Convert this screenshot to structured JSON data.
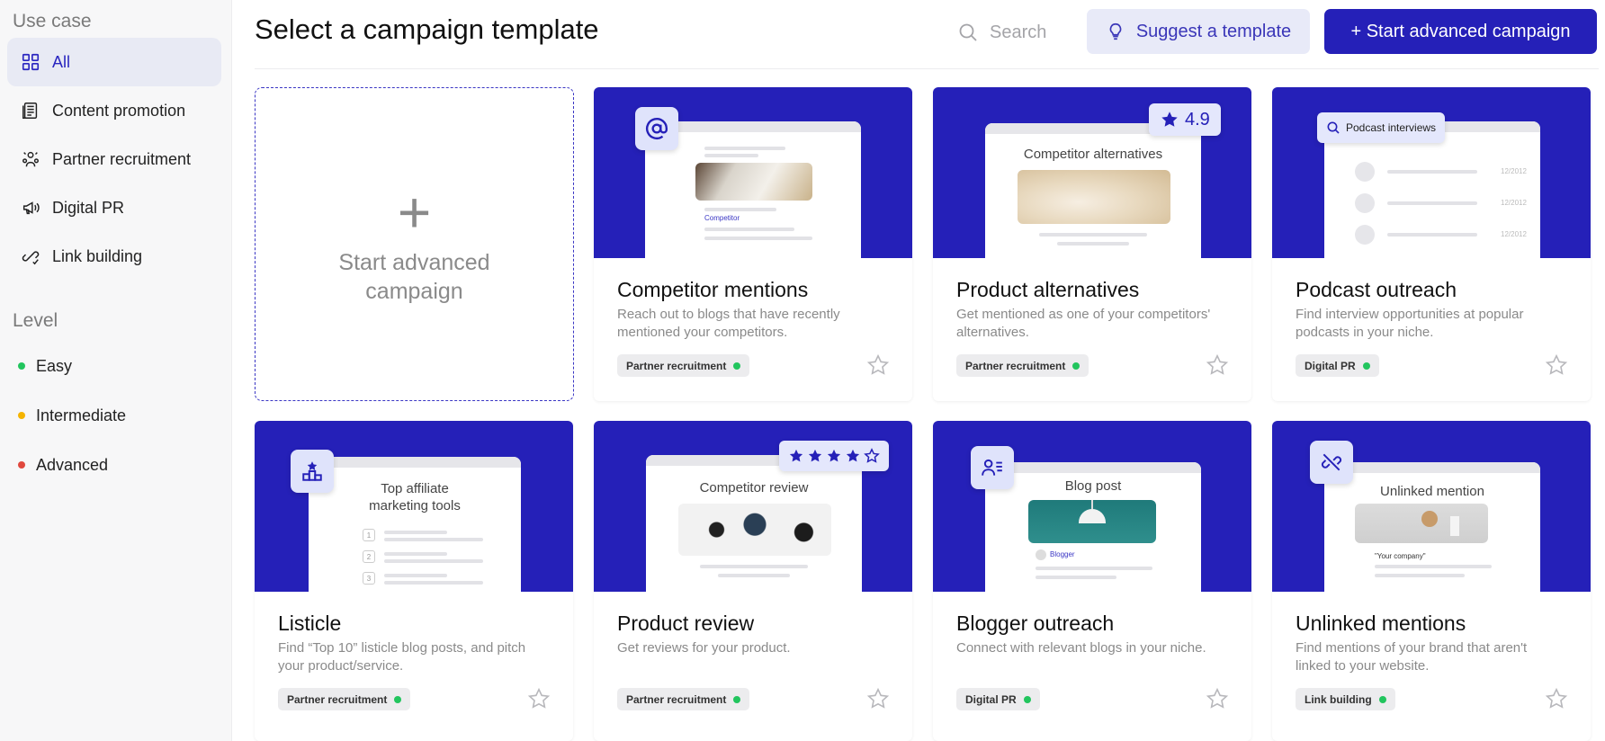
{
  "sidebar": {
    "use_case_heading": "Use case",
    "use_case_items": [
      {
        "label": "All",
        "icon": "grid-icon",
        "active": true
      },
      {
        "label": "Content promotion",
        "icon": "document-icon"
      },
      {
        "label": "Partner recruitment",
        "icon": "partners-icon"
      },
      {
        "label": "Digital PR",
        "icon": "megaphone-icon"
      },
      {
        "label": "Link building",
        "icon": "link-build-icon"
      }
    ],
    "level_heading": "Level",
    "level_items": [
      {
        "label": "Easy",
        "color": "#22c55e"
      },
      {
        "label": "Intermediate",
        "color": "#f5b400"
      },
      {
        "label": "Advanced",
        "color": "#e0483e"
      }
    ]
  },
  "header": {
    "title": "Select a campaign template",
    "search_placeholder": "Search",
    "suggest_label": "Suggest a template",
    "start_label": "+ Start advanced campaign"
  },
  "new_card": {
    "plus": "+",
    "label": "Start advanced campaign"
  },
  "colors": {
    "brand": "#2520b8",
    "tag_green": "#22c55e"
  },
  "cards": [
    {
      "title": "Competitor mentions",
      "description": "Reach out to blogs that have recently mentioned your competitors.",
      "tag": "Partner recruitment",
      "badge_icon": "at-icon",
      "mock_text": "Competitor"
    },
    {
      "title": "Product alternatives",
      "description": "Get mentioned as one of your competitors' alternatives.",
      "tag": "Partner recruitment",
      "rating": "4.9",
      "mock_heading": "Competitor alternatives"
    },
    {
      "title": "Podcast outreach",
      "description": "Find interview opportunities at popular podcasts in your niche.",
      "tag": "Digital PR",
      "badge_label": "Podcast interviews",
      "mock_dates": [
        "12/2012",
        "12/2012",
        "12/2012"
      ]
    },
    {
      "title": "Listicle",
      "description": "Find “Top 10” listicle blog posts, and pitch your product/service.",
      "tag": "Partner recruitment",
      "badge_icon": "podium-icon",
      "mock_heading": "Top affiliate marketing tools",
      "mock_numbers": [
        "1",
        "2",
        "3"
      ]
    },
    {
      "title": "Product review",
      "description": "Get reviews for your product.",
      "tag": "Partner recruitment",
      "stars_filled": 4,
      "stars_total": 5,
      "mock_heading": "Competitor review"
    },
    {
      "title": "Blogger outreach",
      "description": "Connect with relevant blogs in your niche.",
      "tag": "Digital PR",
      "badge_icon": "user-list-icon",
      "mock_heading": "Blog post",
      "mock_author": "Blogger"
    },
    {
      "title": "Unlinked mentions",
      "description": "Find mentions of your brand that aren't linked to your website.",
      "tag": "Link building",
      "badge_icon": "unlink-icon",
      "mock_heading": "Unlinked mention",
      "mock_quote": "\"Your company\""
    }
  ]
}
